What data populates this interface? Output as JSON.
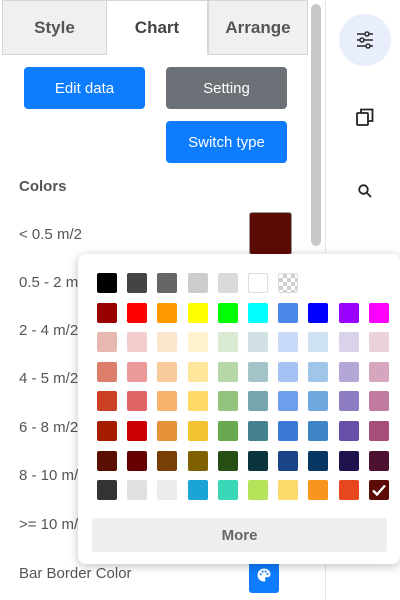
{
  "tabs": [
    {
      "label": "Style",
      "active": false
    },
    {
      "label": "Chart",
      "active": true
    },
    {
      "label": "Arrange",
      "active": false
    }
  ],
  "buttons": {
    "edit_data": "Edit data",
    "setting": "Setting",
    "switch_type": "Switch type"
  },
  "colors_section": {
    "title": "Colors",
    "rows": [
      {
        "label": "< 0.5 m/2",
        "color": "#5c0a05"
      },
      {
        "label": "0.5 - 2 m"
      },
      {
        "label": "2 - 4 m/2"
      },
      {
        "label": "4 - 5 m/2"
      },
      {
        "label": "6 - 8 m/2"
      },
      {
        "label": "8 - 10 m/"
      },
      {
        "label": ">= 10 m/"
      }
    ],
    "bar_border_color_label": "Bar Border Color"
  },
  "toolbar": {
    "icons": [
      "sliders-icon",
      "pages-icon",
      "search-icon"
    ]
  },
  "palette": {
    "rows": [
      [
        "#000000",
        "#444444",
        "#666666",
        "#cccccc",
        "#d9d9d9",
        "#ffffff",
        "transparent"
      ],
      [
        "#990000",
        "#ff0000",
        "#ff9900",
        "#ffff00",
        "#00ff00",
        "#00ffff",
        "#4a86e8",
        "#0000ff",
        "#9900ff",
        "#ff00ff"
      ],
      [
        "#e6b8af",
        "#f4cccc",
        "#fce5cd",
        "#fff2cc",
        "#d9ead3",
        "#d0e0e3",
        "#c9daf8",
        "#cfe2f3",
        "#d9d2e9",
        "#ead1dc"
      ],
      [
        "#dd7e6b",
        "#ea9999",
        "#f9cb9c",
        "#ffe599",
        "#b6d7a8",
        "#a2c4c9",
        "#a4c2f4",
        "#9fc5e8",
        "#b4a7d6",
        "#d5a6bd"
      ],
      [
        "#cc4125",
        "#e06666",
        "#f6b26b",
        "#ffd966",
        "#93c47d",
        "#76a5af",
        "#6d9eeb",
        "#6fa8dc",
        "#8e7cc3",
        "#c27ba0"
      ],
      [
        "#a61c00",
        "#cc0000",
        "#e69138",
        "#f1c232",
        "#6aa84f",
        "#45818e",
        "#3c78d8",
        "#3d85c6",
        "#674ea7",
        "#a64d79"
      ],
      [
        "#5b0f00",
        "#660000",
        "#783f04",
        "#7f6000",
        "#274e13",
        "#0c343d",
        "#1c4587",
        "#073763",
        "#20124d",
        "#4c1130"
      ],
      [
        "#333333",
        "#e0e0e0",
        "#ececec",
        "#1aa5d6",
        "#3ad7b8",
        "#b5e35a",
        "#fbd96a",
        "#f9951f",
        "#e8461c",
        "#5c0a05"
      ]
    ],
    "selected": "#5c0a05",
    "more_label": "More"
  }
}
